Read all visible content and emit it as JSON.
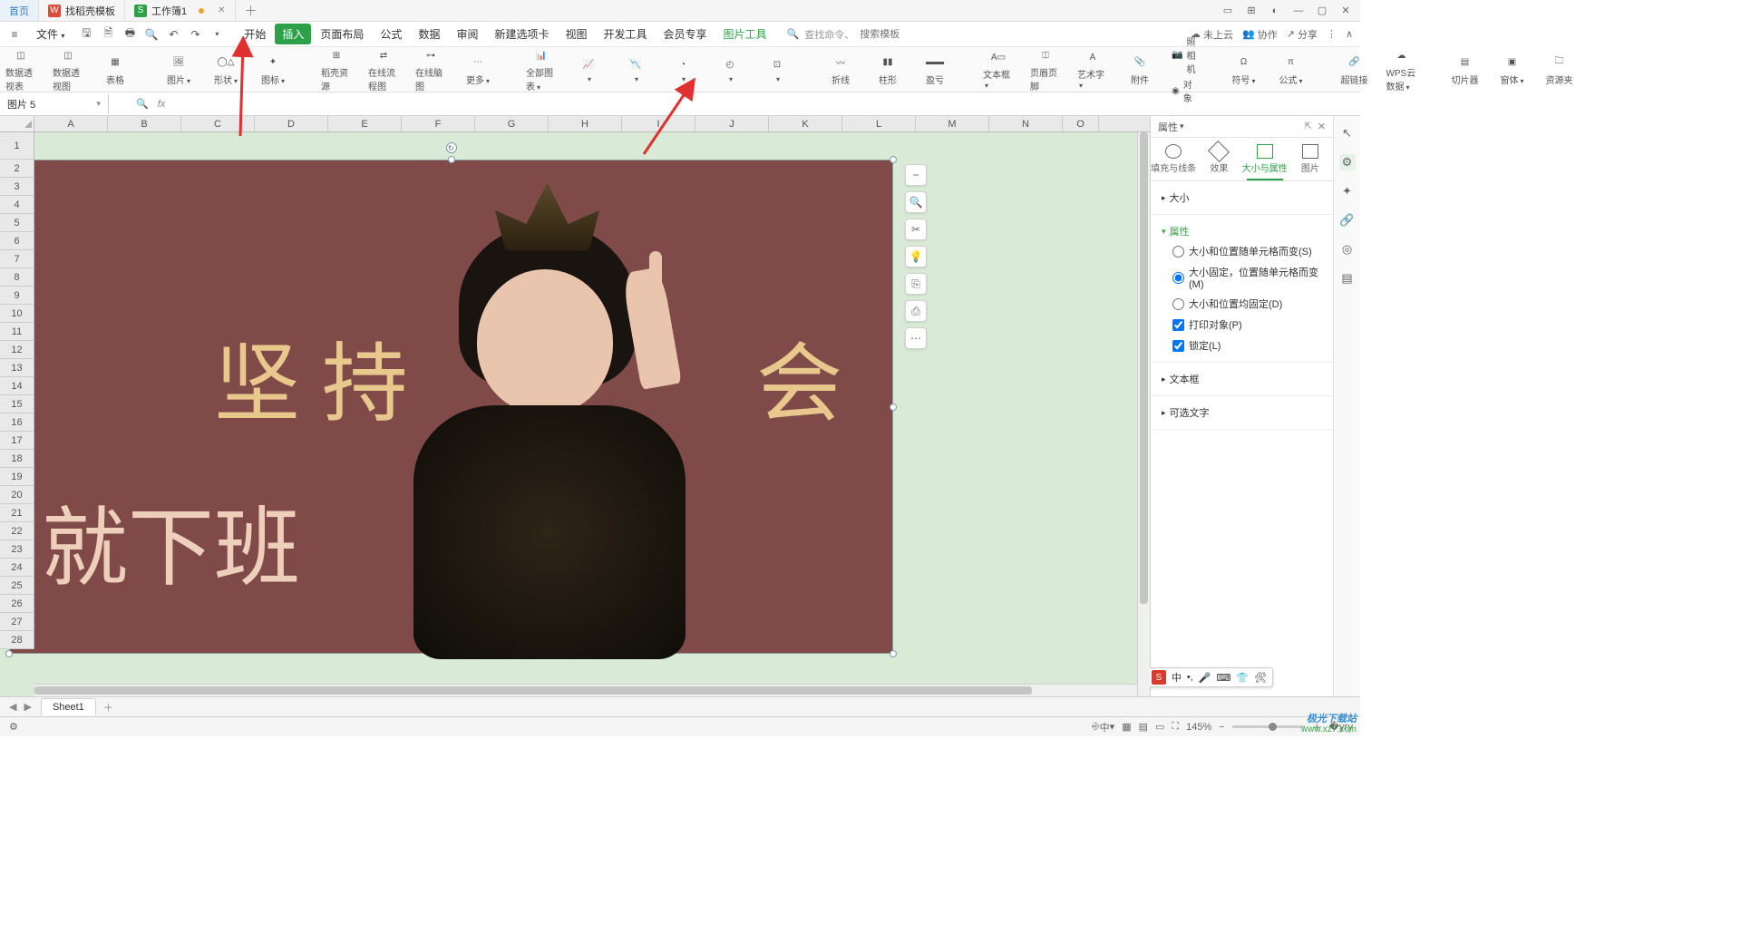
{
  "tabs": {
    "home": "首页",
    "t1": "找稻壳模板",
    "t2": "工作簿1"
  },
  "menu": {
    "file": "文件",
    "items": [
      "开始",
      "插入",
      "页面布局",
      "公式",
      "数据",
      "审阅",
      "新建选项卡",
      "视图",
      "开发工具",
      "会员专享",
      "图片工具"
    ],
    "search_icon_hint": "查找命令、",
    "search_placeholder": "搜索模板"
  },
  "menu_right": {
    "cloud": "未上云",
    "coop": "协作",
    "share": "分享"
  },
  "ribbon": [
    "数据透视表",
    "数据透视图",
    "表格",
    "图片",
    "形状",
    "图标",
    "稻壳资源",
    "在线流程图",
    "在线脑图",
    "更多",
    "全部图表",
    "",
    "",
    "",
    "",
    "",
    "折线",
    "柱形",
    "盈亏",
    "文本框",
    "页眉页脚",
    "艺术字",
    "附件",
    "照相机",
    "对象",
    "符号",
    "公式",
    "超链接",
    "WPS云数据",
    "切片器",
    "窗体",
    "资源夹"
  ],
  "name_box": "图片 5",
  "fx_label": "fx",
  "columns": [
    "A",
    "B",
    "C",
    "D",
    "E",
    "F",
    "G",
    "H",
    "I",
    "J",
    "K",
    "L",
    "M",
    "N",
    "O"
  ],
  "rows": [
    "1",
    "2",
    "3",
    "4",
    "5",
    "6",
    "7",
    "8",
    "9",
    "10",
    "11",
    "12",
    "13",
    "14",
    "15",
    "16",
    "17",
    "18",
    "19",
    "20",
    "21",
    "22",
    "23",
    "24",
    "25",
    "26",
    "27",
    "28"
  ],
  "image_text": {
    "t1": "坚 持",
    "t2": "会",
    "t3": "就下班"
  },
  "float_icons": [
    "−",
    "🔍",
    "✂",
    "💡",
    "⎘",
    "⎙",
    "⋯"
  ],
  "panel": {
    "title": "属性",
    "tabs": [
      "填充与线条",
      "效果",
      "大小与属性",
      "图片"
    ],
    "sec_size": "大小",
    "sec_props": "属性",
    "opts": [
      "大小和位置随单元格而变(S)",
      "大小固定，位置随单元格而变(M)",
      "大小和位置均固定(D)"
    ],
    "chk1": "打印对象(P)",
    "chk2": "锁定(L)",
    "sec_textbox": "文本框",
    "sec_alttext": "可选文字"
  },
  "sheet_tab": "Sheet1",
  "status": {
    "ime": "中",
    "zoom": "145%"
  },
  "watermark": {
    "l1": "极光下载站",
    "l2": "www.xz7.com"
  }
}
